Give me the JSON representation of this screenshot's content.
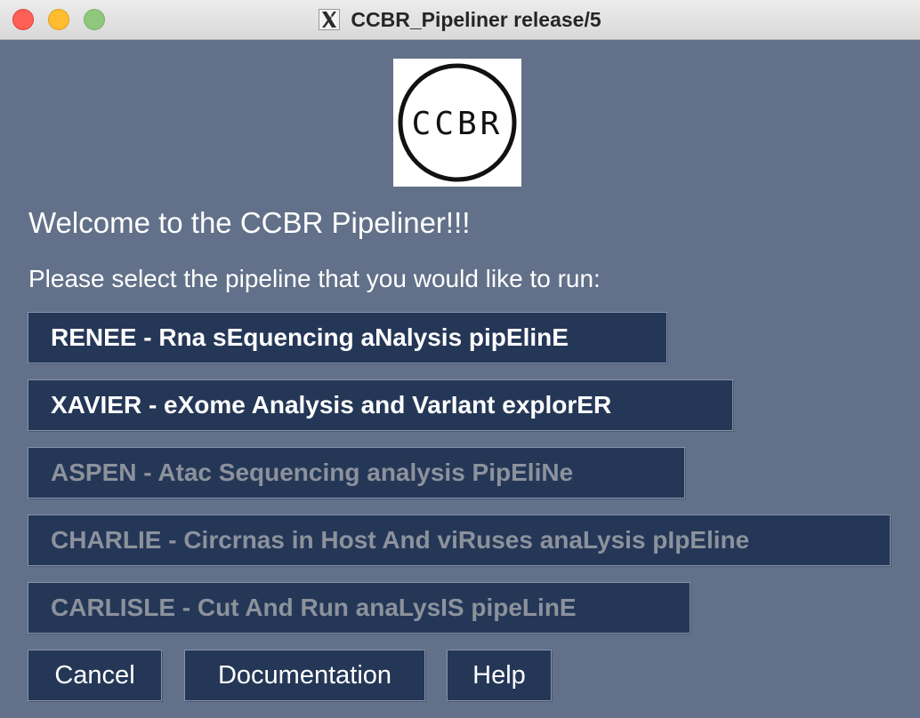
{
  "window": {
    "title": "CCBR_Pipeliner release/5",
    "logo_text": "CCBR"
  },
  "main": {
    "welcome": "Welcome to the CCBR Pipeliner!!!",
    "prompt": "Please select the pipeline that you would like to run:"
  },
  "pipelines": [
    {
      "label": "RENEE - Rna sEquencing aNalysis pipElinE",
      "enabled": true
    },
    {
      "label": "XAVIER - eXome Analysis and VarIant explorER",
      "enabled": true
    },
    {
      "label": "ASPEN - Atac Sequencing analysis PipEliNe",
      "enabled": false
    },
    {
      "label": "CHARLIE - Circrnas in Host And viRuses anaLysis pIpEline",
      "enabled": false
    },
    {
      "label": "CARLISLE - Cut And Run anaLysIS pipeLinE",
      "enabled": false
    }
  ],
  "actions": {
    "cancel": "Cancel",
    "documentation": "Documentation",
    "help": "Help"
  },
  "colors": {
    "background": "#627189",
    "button": "#253757",
    "text": "#ffffff",
    "disabled_text": "#8c929c"
  },
  "icons": {
    "window_icon": "x11-icon",
    "close": "close-window-icon",
    "minimize": "minimize-window-icon",
    "maximize": "zoom-window-icon"
  }
}
